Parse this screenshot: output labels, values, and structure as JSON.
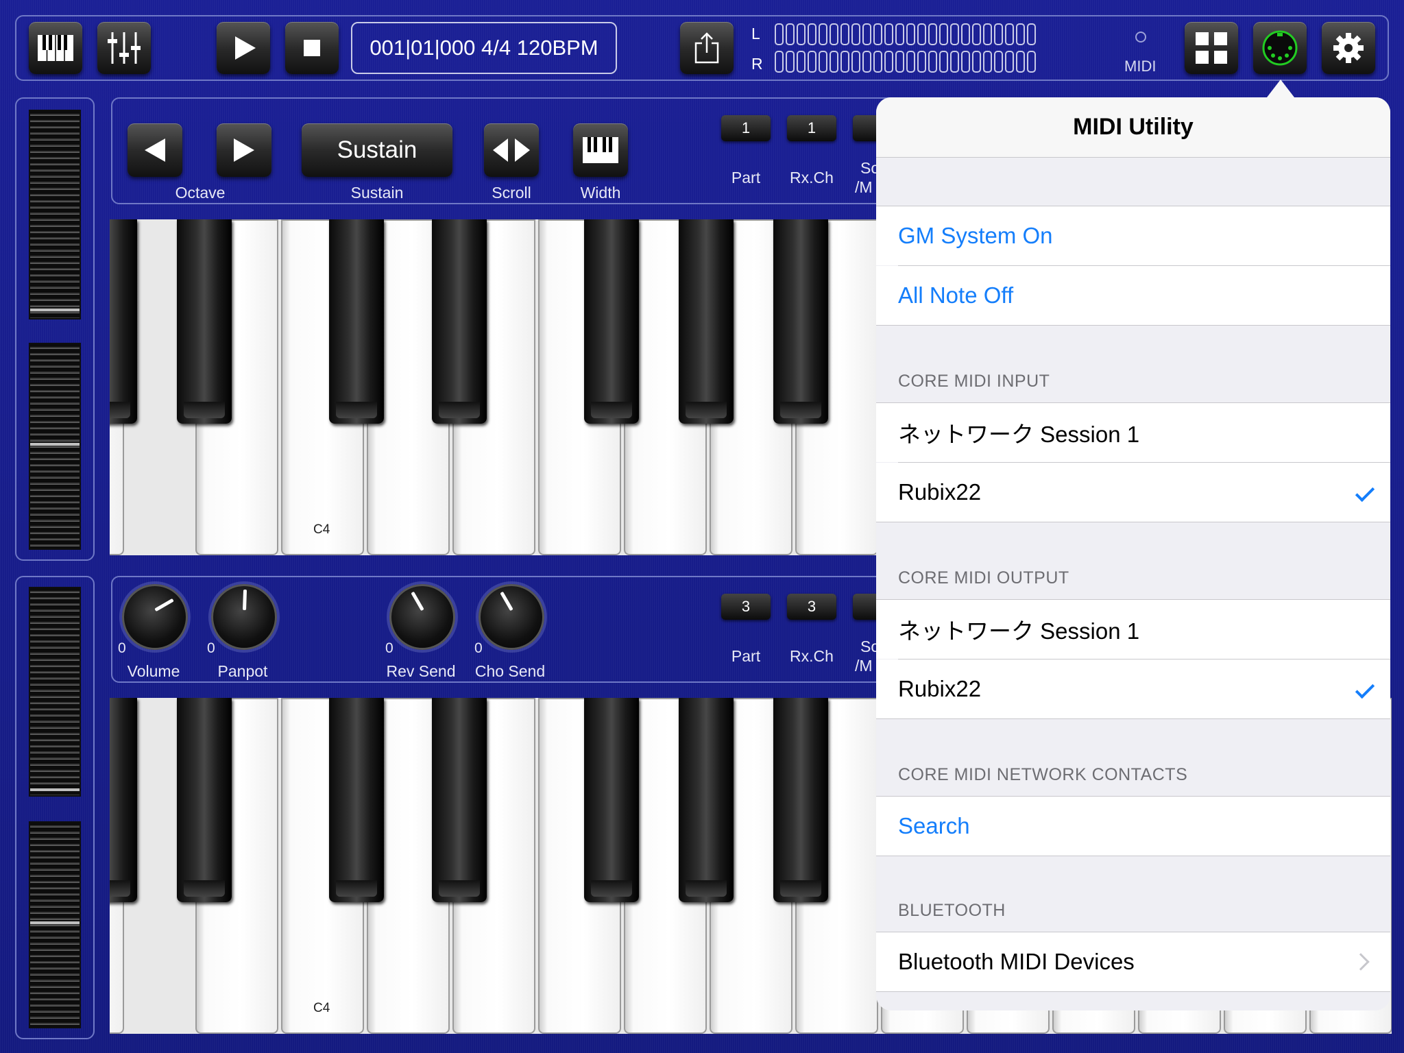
{
  "toolbar": {
    "transport_display": "001|01|000 4/4 120BPM",
    "meter_left": "L",
    "meter_right": "R",
    "midi_label": "MIDI"
  },
  "upper_part": {
    "octave_label": "Octave",
    "sustain_button": "Sustain",
    "sustain_label": "Sustain",
    "scroll_label": "Scroll",
    "width_label": "Width",
    "part_value": "1",
    "part_label": "Part",
    "rxch_value": "1",
    "rxch_label": "Rx.Ch",
    "cut_label_1": "So",
    "cut_label_2": "/M",
    "c4_label": "C4"
  },
  "lower_part": {
    "volume_value": "0",
    "volume_label": "Volume",
    "panpot_value": "0",
    "panpot_label": "Panpot",
    "rev_value": "0",
    "rev_label": "Rev Send",
    "cho_value": "0",
    "cho_label": "Cho Send",
    "part_value": "3",
    "part_label": "Part",
    "rxch_value": "3",
    "rxch_label": "Rx.Ch",
    "cut_label_1": "So",
    "cut_label_2": "/M",
    "c4_label": "C4"
  },
  "popover": {
    "title": "MIDI Utility",
    "gm_system_on": "GM System On",
    "all_note_off": "All Note Off",
    "input_header": "CORE MIDI INPUT",
    "input_items": [
      {
        "label": "ネットワーク Session 1",
        "checked": false
      },
      {
        "label": "Rubix22",
        "checked": true
      }
    ],
    "output_header": "CORE MIDI OUTPUT",
    "output_items": [
      {
        "label": "ネットワーク Session 1",
        "checked": false
      },
      {
        "label": "Rubix22",
        "checked": true
      }
    ],
    "network_header": "CORE MIDI NETWORK CONTACTS",
    "search": "Search",
    "bluetooth_header": "BLUETOOTH",
    "bluetooth_devices": "Bluetooth MIDI Devices"
  },
  "icons": {
    "keyboard": "keyboard-icon",
    "mixer": "mixer-sliders-icon",
    "play": "play-icon",
    "stop": "stop-icon",
    "share": "share-icon",
    "grid": "grid-icon",
    "midi_port": "midi-din-icon",
    "settings": "gear-icon"
  },
  "colors": {
    "background": "#161c88",
    "link_blue": "#147efb",
    "midi_led_green": "#22cc22"
  }
}
